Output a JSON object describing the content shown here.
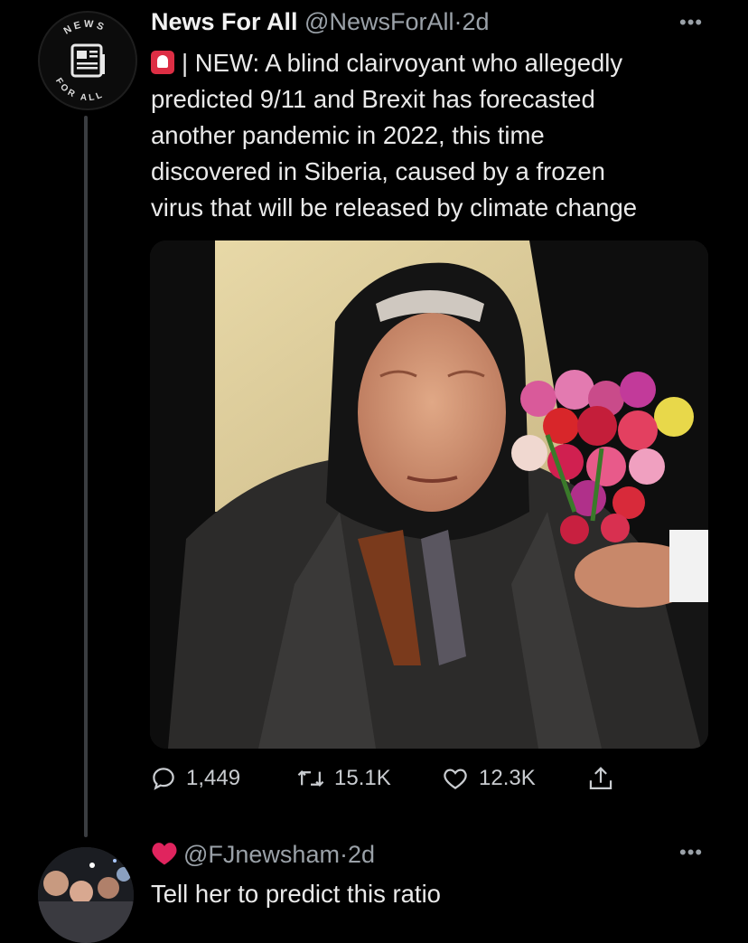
{
  "tweet": {
    "avatar_text_top": "NEWS",
    "avatar_text_bottom": "FOR ALL",
    "author_name": "News For All",
    "handle": "@NewsForAll",
    "separator": "·",
    "time": "2d",
    "more_icon": "more-horizontal-icon",
    "lines": [
      "| NEW: A blind clairvoyant who allegedly",
      "predicted 9/11 and Brexit has forecasted",
      "another pandemic in 2022, this time",
      "discovered in Siberia, caused by a frozen",
      "virus that will be released by climate change"
    ],
    "actions": {
      "replies": "1,449",
      "retweets": "15.1K",
      "likes": "12.3K"
    }
  },
  "reply": {
    "handle": "@FJnewsham",
    "separator": "·",
    "time": "2d",
    "text": "Tell her to predict this ratio"
  },
  "colors": {
    "background": "#000000",
    "text": "#e7e9ea",
    "muted": "#9aa1a8",
    "siren": "#dd2e44",
    "heart": "#e0245e"
  }
}
